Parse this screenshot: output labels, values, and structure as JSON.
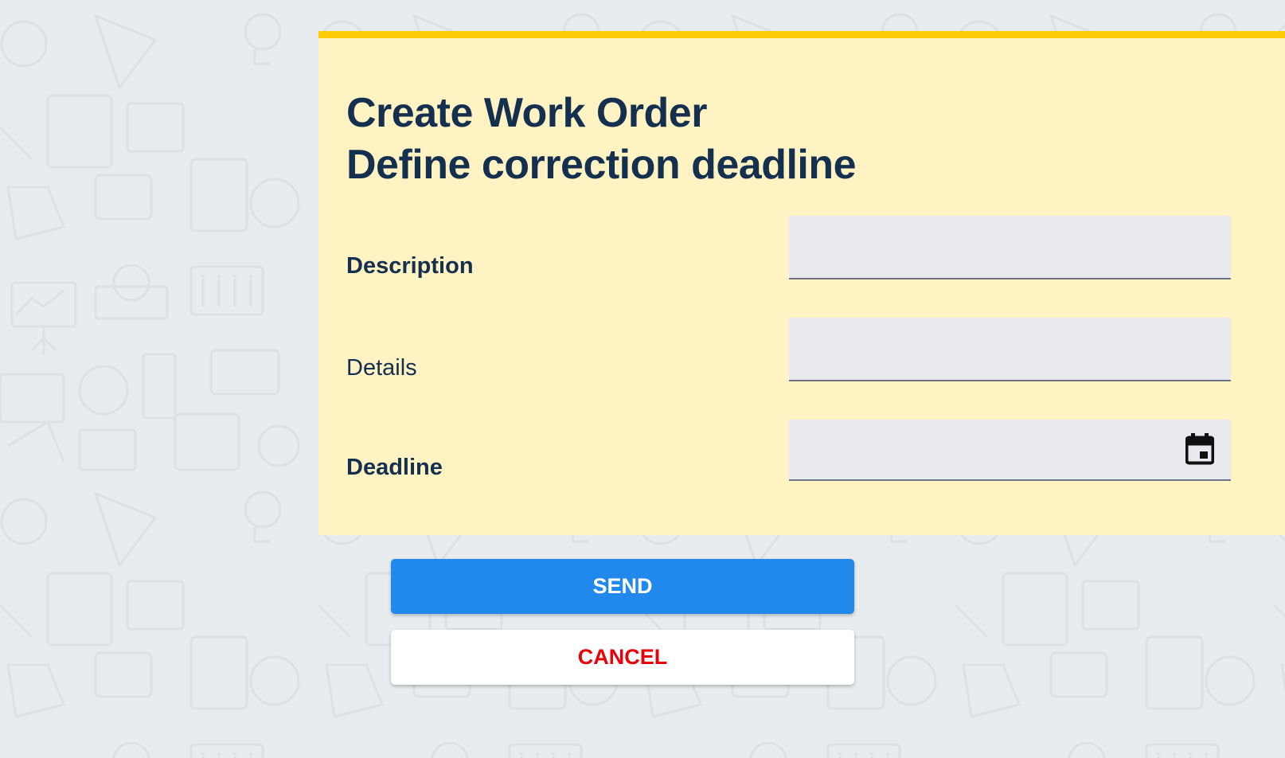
{
  "form": {
    "title_line1": "Create Work Order",
    "title_line2": "Define correction deadline",
    "fields": [
      {
        "label": "Description",
        "value": "",
        "placeholder": ""
      },
      {
        "label": "Details",
        "value": "",
        "placeholder": ""
      },
      {
        "label": "Deadline",
        "value": "",
        "placeholder": ""
      }
    ],
    "deadline_icon": "calendar-icon"
  },
  "actions": {
    "send_label": "SEND",
    "cancel_label": "CANCEL"
  },
  "colors": {
    "card_background": "#fff3c4",
    "card_accent": "#ffcc0a",
    "text_primary": "#15304f",
    "send_button": "#2289ec",
    "cancel_text": "#e8000a",
    "page_background": "#e9ecef"
  }
}
